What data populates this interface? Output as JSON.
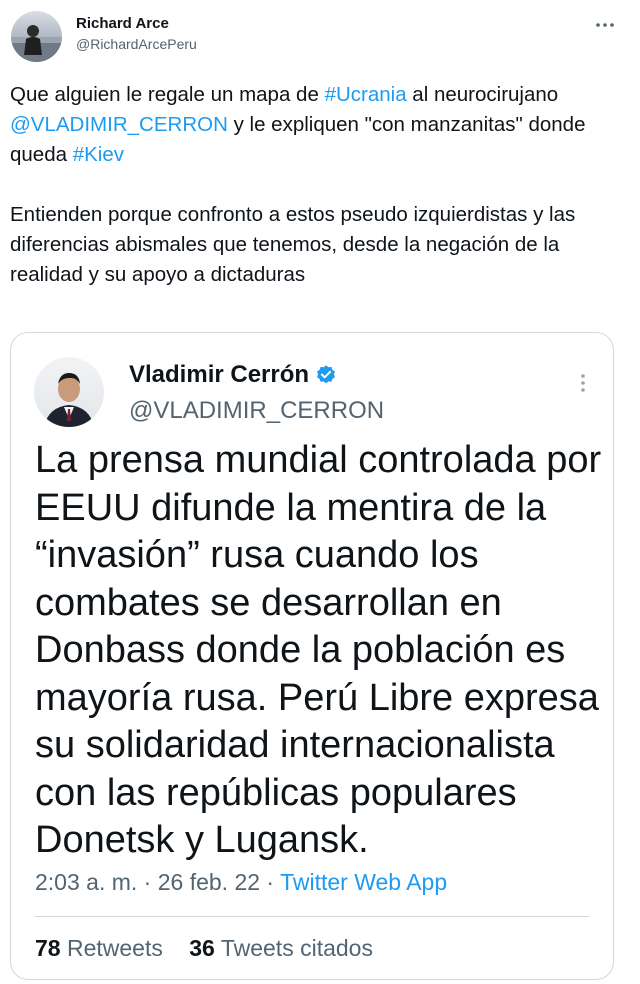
{
  "author": {
    "name": "Richard Arce",
    "handle": "@RichardArcePeru"
  },
  "tweet": {
    "p1_a": "Que alguien le regale un mapa de ",
    "p1_tag1": "#Ucrania",
    "p1_b": " al neurocirujano ",
    "p1_mention": "@VLADIMIR_CERRON",
    "p1_c": " y le expliquen \"con manzanitas\" donde queda ",
    "p1_tag2": "#Kiev",
    "p2": "Entienden porque confronto a estos pseudo izquierdistas y las diferencias abismales que tenemos, desde la negación de la realidad y su apoyo a dictaduras"
  },
  "quote": {
    "name": "Vladimir Cerrón",
    "handle": "@VLADIMIR_CERRON",
    "text": "La prensa mundial controlada por EEUU difunde la mentira de la “invasión” rusa cuando los combates se desarrollan en Donbass donde la población es mayoría rusa. Perú Libre expresa su solidaridad internacionalista con las repúblicas populares Donetsk y Lugansk.",
    "time": "2:03 a. m.",
    "sep": " · ",
    "date": "26 feb. 22",
    "source": "Twitter Web App",
    "retweets_count": "78",
    "retweets_label": "Retweets",
    "quotes_count": "36",
    "quotes_label": "Tweets citados"
  },
  "colors": {
    "accent": "#1d9bf0",
    "secondary_text": "#536471",
    "border": "#cfd9de"
  },
  "icons": {
    "more": "more-horizontal-icon",
    "more_quote": "more-vertical-icon",
    "verified": "verified-badge-icon"
  }
}
